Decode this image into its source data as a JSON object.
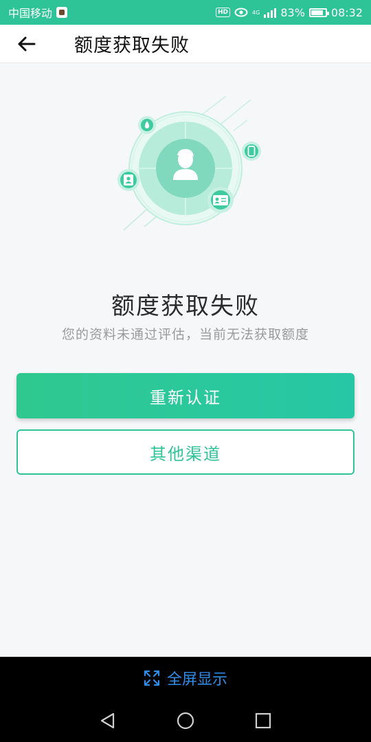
{
  "status_bar": {
    "carrier": "中国移动",
    "hd_label": "HD",
    "network": "4G",
    "battery": "83%",
    "time": "08:32"
  },
  "header": {
    "title": "额度获取失败",
    "back_icon": "arrow-left-icon"
  },
  "result": {
    "title": "额度获取失败",
    "subtitle": "您的资料未通过评估，当前无法获取额度"
  },
  "actions": {
    "primary_label": "重新认证",
    "secondary_label": "其他渠道"
  },
  "system": {
    "fullscreen_label": "全屏显示",
    "nav_icons": [
      "back-triangle-icon",
      "home-circle-icon",
      "recents-square-icon"
    ]
  },
  "colors": {
    "accent": "#2ec497",
    "status_bar": "#2ec497",
    "fullscreen_text": "#2f8ce8"
  }
}
